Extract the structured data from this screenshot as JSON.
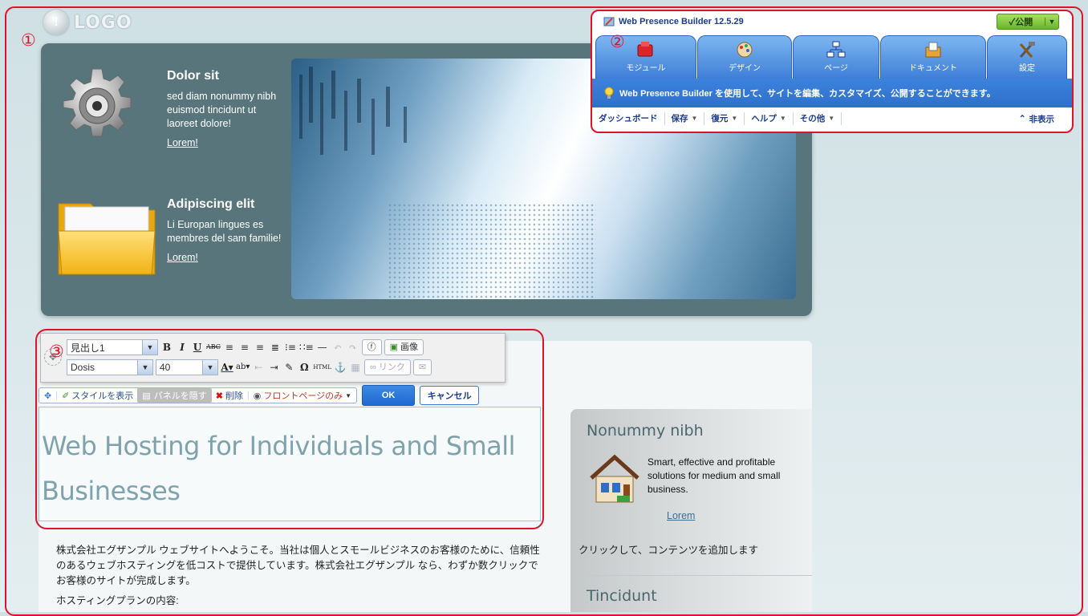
{
  "logo": {
    "text": "LOGO"
  },
  "hero": {
    "block1": {
      "title": "Dolor sit",
      "text": "sed diam nonummy nibh euismod tincidunt ut laoreet dolore!",
      "link": "Lorem!"
    },
    "block2": {
      "title": "Adipiscing elit",
      "text": "Li Europan lingues es membres del sam familie!",
      "link": "Lorem!"
    }
  },
  "annotations": {
    "one": "①",
    "two": "②",
    "three": "③"
  },
  "wpb": {
    "title": "Web Presence Builder 12.5.29",
    "publish": "公開",
    "tabs": [
      {
        "label": "モジュール",
        "icon": "modules-icon"
      },
      {
        "label": "デザイン",
        "icon": "design-icon"
      },
      {
        "label": "ページ",
        "icon": "pages-icon"
      },
      {
        "label": "ドキュメント",
        "icon": "document-icon"
      },
      {
        "label": "設定",
        "icon": "settings-icon"
      }
    ],
    "tip": "Web Presence Builder を使用して、サイトを編集、カスタマイズ、公開することができます。",
    "menu": {
      "dashboard": "ダッシュボード",
      "save": "保存",
      "restore": "復元",
      "help": "ヘルプ",
      "more": "その他",
      "hide": "非表示"
    }
  },
  "editor": {
    "style_select": "見出し1",
    "font_select": "Dosis",
    "size_select": "40",
    "image_btn": "画像",
    "link_btn": "リンク",
    "html_btn": "HTML"
  },
  "actions": {
    "show_styles": "スタイルを表示",
    "hide_panel": "パネルを隠す",
    "delete": "削除",
    "front_page": "フロントページのみ",
    "ok": "OK",
    "cancel": "キャンセル"
  },
  "content": {
    "heading_line1": "Web Hosting for Individuals and Small",
    "heading_line2": "Businesses",
    "paragraph": "株式会社エグザンプル ウェブサイトへようこそ。当社は個人とスモールビジネスのお客様のために、信頼性のあるウェブホスティングを低コストで提供しています。株式会社エグザンプル なら、わずか数クリックでお客様のサイトが完成します。",
    "plans": "ホスティングプランの内容:"
  },
  "sidebar": {
    "title1": "Nonummy nibh",
    "text": "Smart, effective and profitable solutions for medium and small business.",
    "link": "Lorem",
    "click_add": "クリックして、コンテンツを追加します",
    "title2": "Tincidunt"
  },
  "colors": {
    "annotation": "#e0122b",
    "hero_bg": "#57757b",
    "tab_blue": "#3f7fd8",
    "publish_green": "#6ab42c"
  }
}
